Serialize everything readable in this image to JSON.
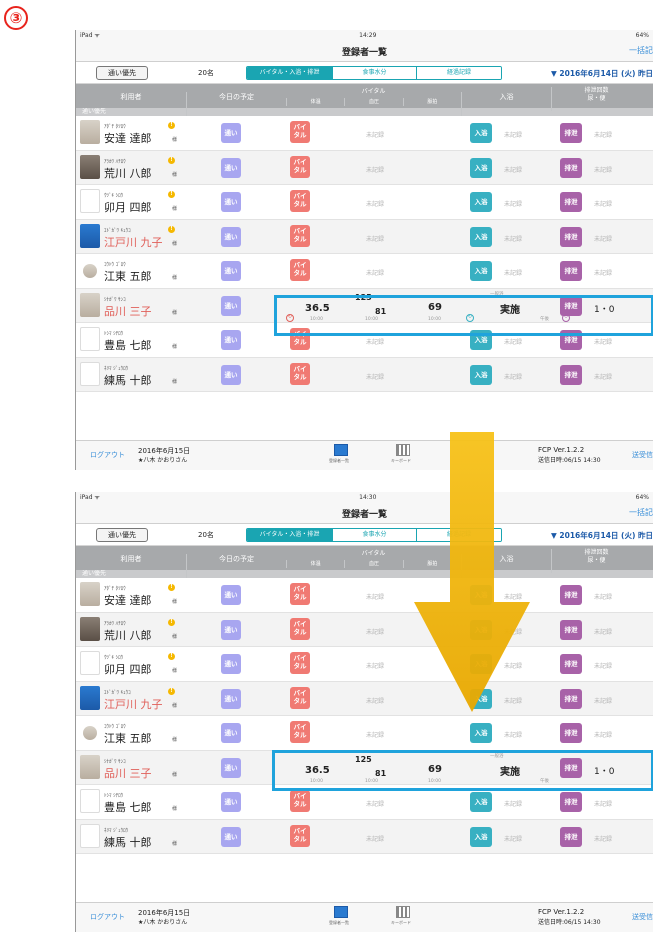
{
  "step_label": "③",
  "screens": [
    {
      "status_left": "iPad ᯤ",
      "status_time": "14:29",
      "status_battery": "64%",
      "nav_title": "登録者一覧",
      "nav_right": "一括記",
      "sort_button": "通い優先",
      "count": "20名",
      "segments": [
        "バイタル・入浴・排泄",
        "食事水分",
        "経過記録"
      ],
      "date": "▼ 2016年6月14日 (火) 昨日",
      "col_user": "利用者",
      "col_plan": "今日の予定",
      "col_vital": "バイタル",
      "col_vital_sub": [
        "体温",
        "血圧",
        "脈拍"
      ],
      "col_bath": "入浴",
      "col_excr": "排泄回数\n尿・便",
      "group": "通い優先",
      "sync_mark": "↻",
      "rows": [
        {
          "kana": "ｱﾀﾞﾁ ﾀﾂﾛｳ",
          "name": "安達 達郎",
          "sama": "様",
          "warn": "!",
          "avatar": "photo"
        },
        {
          "kana": "ｱﾗｶﾜ ﾊﾁﾛｳ",
          "name": "荒川 八郎",
          "sama": "様",
          "warn": "!",
          "avatar": "dark"
        },
        {
          "kana": "ｳﾂﾞｷ ｼﾛｳ",
          "name": "卯月 四郎",
          "sama": "様",
          "warn": "!",
          "avatar": "blank"
        },
        {
          "kana": "ｴﾄﾞｶﾞﾜ ｷｭｳｺ",
          "name": "江戸川 九子",
          "sama": "様",
          "warn": "!",
          "avatar": "blue",
          "red": true
        },
        {
          "kana": "ｺｳﾄｳ ｺﾞﾛｳ",
          "name": "江東 五郎",
          "sama": "様",
          "avatar": "tiny"
        },
        {
          "kana": "ｼﾅｶﾞﾜ ｻﾝｺ",
          "name": "品川 三子",
          "sama": "様",
          "avatar": "photo",
          "red": true,
          "recorded": true
        },
        {
          "kana": "ﾄｼﾏ ｼﾁﾛｳ",
          "name": "豊島 七郎",
          "sama": "様",
          "avatar": "blank"
        },
        {
          "kana": "ﾈﾘﾏ ｼﾞｭｳﾛｳ",
          "name": "練馬 十郎",
          "sama": "様",
          "avatar": "blank"
        }
      ],
      "labels": {
        "tsuusho": "通い",
        "vital": "バイ\nタル",
        "bath": "入浴",
        "excr": "排泄",
        "mikiroku": "未記録"
      },
      "record": {
        "temp": "36.5",
        "bp_high": "125",
        "bp_low": "81",
        "pulse": "69",
        "time": "10:00",
        "bath_type": "一般浴",
        "bath_result": "実施",
        "bath_time": "午後",
        "excr": "1・0"
      },
      "show_sync": true,
      "bottom": {
        "logout": "ログアウト",
        "date": "2016年6月15日",
        "staff": "★八木 かおりさん",
        "tab1": "登録者一覧",
        "tab2": "キーボード",
        "version": "FCP Ver.1.2.2",
        "sent": "送信日時:06/15 14:30",
        "send": "送受信"
      }
    },
    {
      "status_left": "iPad ᯤ",
      "status_time": "14:30",
      "status_battery": "64%",
      "nav_title": "登録者一覧",
      "nav_right": "一括記",
      "sort_button": "通い優先",
      "count": "20名",
      "segments": [
        "バイタル・入浴・排泄",
        "食事水分",
        "経過記録"
      ],
      "date": "▼ 2016年6月14日 (火) 昨日",
      "col_user": "利用者",
      "col_plan": "今日の予定",
      "col_vital": "バイタル",
      "col_vital_sub": [
        "体温",
        "血圧",
        "脈拍"
      ],
      "col_bath": "入浴",
      "col_excr": "排泄回数\n尿・便",
      "group": "通い優先",
      "sync_mark": "↻",
      "rows": [
        {
          "kana": "ｱﾀﾞﾁ ﾀﾂﾛｳ",
          "name": "安達 達郎",
          "sama": "様",
          "warn": "!",
          "avatar": "photo"
        },
        {
          "kana": "ｱﾗｶﾜ ﾊﾁﾛｳ",
          "name": "荒川 八郎",
          "sama": "様",
          "warn": "!",
          "avatar": "dark"
        },
        {
          "kana": "ｳﾂﾞｷ ｼﾛｳ",
          "name": "卯月 四郎",
          "sama": "様",
          "warn": "!",
          "avatar": "blank"
        },
        {
          "kana": "ｴﾄﾞｶﾞﾜ ｷｭｳｺ",
          "name": "江戸川 九子",
          "sama": "様",
          "warn": "!",
          "avatar": "blue",
          "red": true
        },
        {
          "kana": "ｺｳﾄｳ ｺﾞﾛｳ",
          "name": "江東 五郎",
          "sama": "様",
          "avatar": "tiny"
        },
        {
          "kana": "ｼﾅｶﾞﾜ ｻﾝｺ",
          "name": "品川 三子",
          "sama": "様",
          "avatar": "photo",
          "red": true,
          "recorded": true
        },
        {
          "kana": "ﾄｼﾏ ｼﾁﾛｳ",
          "name": "豊島 七郎",
          "sama": "様",
          "avatar": "blank"
        },
        {
          "kana": "ﾈﾘﾏ ｼﾞｭｳﾛｳ",
          "name": "練馬 十郎",
          "sama": "様",
          "avatar": "blank"
        }
      ],
      "labels": {
        "tsuusho": "通い",
        "vital": "バイ\nタル",
        "bath": "入浴",
        "excr": "排泄",
        "mikiroku": "未記録"
      },
      "record": {
        "temp": "36.5",
        "bp_high": "125",
        "bp_low": "81",
        "pulse": "69",
        "time": "10:00",
        "bath_type": "一般浴",
        "bath_result": "実施",
        "bath_time": "午後",
        "excr": "1・0"
      },
      "show_sync": false,
      "bottom": {
        "logout": "ログアウト",
        "date": "2016年6月15日",
        "staff": "★八木 かおりさん",
        "tab1": "登録者一覧",
        "tab2": "キーボード",
        "version": "FCP Ver.1.2.2",
        "sent": "送信日時:06/15 14:30",
        "send": "送受信"
      }
    }
  ],
  "colors": {
    "highlight": "#1fa3dc",
    "arrow": "#f5b800",
    "teal": "#1aa5b2",
    "vital": "#f07a73",
    "bath": "#38b0c2",
    "excr": "#a862a8",
    "tsuusho": "#a8a6f0"
  }
}
